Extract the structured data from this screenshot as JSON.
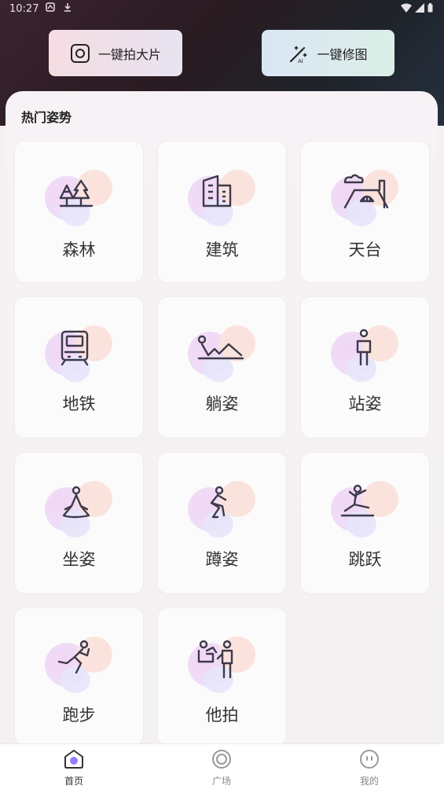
{
  "status_bar": {
    "time": "10:27"
  },
  "quick_actions": {
    "photo_label": "一键拍大片",
    "edit_label": "一键修图"
  },
  "section": {
    "title": "热门姿势"
  },
  "poses": [
    {
      "label": "森林",
      "icon": "trees-icon"
    },
    {
      "label": "建筑",
      "icon": "building-icon"
    },
    {
      "label": "天台",
      "icon": "rooftop-icon"
    },
    {
      "label": "地铁",
      "icon": "subway-icon"
    },
    {
      "label": "躺姿",
      "icon": "lying-pose-icon"
    },
    {
      "label": "站姿",
      "icon": "standing-pose-icon"
    },
    {
      "label": "坐姿",
      "icon": "sitting-pose-icon"
    },
    {
      "label": "蹲姿",
      "icon": "squat-pose-icon"
    },
    {
      "label": "跳跃",
      "icon": "jump-pose-icon"
    },
    {
      "label": "跑步",
      "icon": "running-pose-icon"
    },
    {
      "label": "他拍",
      "icon": "photographer-icon"
    }
  ],
  "tabs": [
    {
      "label": "首页",
      "icon": "home-icon",
      "active": true
    },
    {
      "label": "广场",
      "icon": "square-icon",
      "active": false
    },
    {
      "label": "我的",
      "icon": "profile-icon",
      "active": false
    }
  ],
  "colors": {
    "accent": "#7b5cff",
    "glyph": "#3d3a4a"
  }
}
